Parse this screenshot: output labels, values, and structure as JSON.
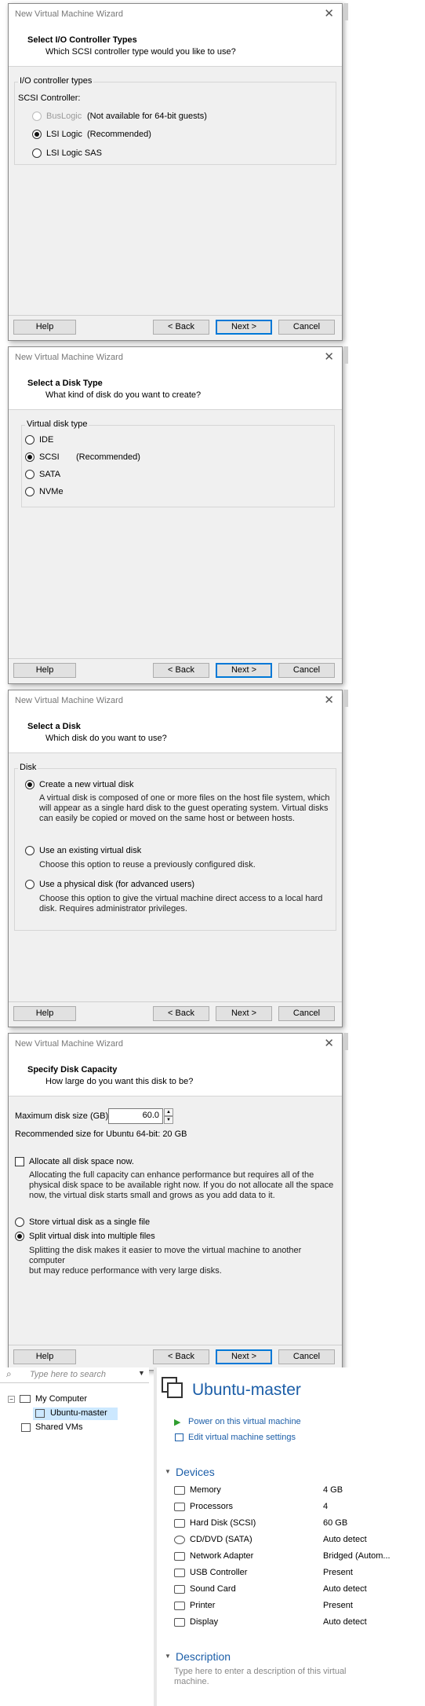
{
  "wizards": [
    {
      "title": "New Virtual Machine Wizard",
      "heading": "Select I/O Controller Types",
      "subheading": "Which SCSI controller type would you like to use?",
      "group_label": "I/O controller types",
      "field_label": "SCSI Controller:",
      "options": [
        {
          "label": "BusLogic",
          "note": "(Not available for 64-bit guests)",
          "state": "disabled"
        },
        {
          "label": "LSI Logic",
          "note": "(Recommended)",
          "state": "selected"
        },
        {
          "label": "LSI Logic SAS",
          "note": "",
          "state": "unselected"
        }
      ]
    },
    {
      "title": "New Virtual Machine Wizard",
      "heading": "Select a Disk Type",
      "subheading": "What kind of disk do you want to create?",
      "group_label": "Virtual disk type",
      "options": [
        {
          "label": "IDE",
          "note": "",
          "state": "unselected"
        },
        {
          "label": "SCSI",
          "note": "(Recommended)",
          "state": "selected"
        },
        {
          "label": "SATA",
          "note": "",
          "state": "unselected"
        },
        {
          "label": "NVMe",
          "note": "",
          "state": "unselected"
        }
      ]
    },
    {
      "title": "New Virtual Machine Wizard",
      "heading": "Select a Disk",
      "subheading": "Which disk do you want to use?",
      "group_label": "Disk",
      "options": [
        {
          "label": "Create a new virtual disk",
          "state": "selected",
          "desc": [
            "A virtual disk is composed of one or more files on the host file system, which",
            "will appear as a single hard disk to the guest operating system. Virtual disks",
            "can easily be copied or moved on the same host or between hosts."
          ]
        },
        {
          "label": "Use an existing virtual disk",
          "state": "unselected",
          "desc": [
            "Choose this option to reuse a previously configured disk."
          ]
        },
        {
          "label": "Use a physical disk (for advanced users)",
          "state": "unselected",
          "desc": [
            "Choose this option to give the virtual machine direct access to a local hard",
            "disk. Requires administrator privileges."
          ]
        }
      ]
    },
    {
      "title": "New Virtual Machine Wizard",
      "heading": "Specify Disk Capacity",
      "subheading": "How large do you want this disk to be?",
      "max_size_label": "Maximum disk size (GB):",
      "max_size_value": "60.0",
      "recommended": "Recommended size for Ubuntu 64-bit: 20 GB",
      "allocate_label": "Allocate all disk space now.",
      "allocate_checked": false,
      "allocate_desc": [
        "Allocating the full capacity can enhance performance but requires all of the",
        "physical disk space to be available right now. If you do not allocate all the space",
        "now, the virtual disk starts small and grows as you add data to it."
      ],
      "store_single": "Store virtual disk as a single file",
      "split_multi": "Split virtual disk into multiple files",
      "split_desc": [
        "Splitting the disk makes it easier to move the virtual machine to another computer",
        "but may reduce performance with very large disks."
      ]
    }
  ],
  "buttons": {
    "help": "Help",
    "back": "< Back",
    "next": "Next >",
    "cancel": "Cancel"
  },
  "library": {
    "search_placeholder": "Type here to search",
    "tree": [
      {
        "label": "My Computer",
        "level": 0,
        "expanded": true
      },
      {
        "label": "Ubuntu-master",
        "level": 1,
        "selected": true
      },
      {
        "label": "Shared VMs",
        "level": 0
      }
    ]
  },
  "vm": {
    "name": "Ubuntu-master",
    "power_on": "Power on this virtual machine",
    "edit_settings": "Edit virtual machine settings",
    "devices_heading": "Devices",
    "devices": [
      {
        "name": "Memory",
        "value": "4 GB",
        "icon": "memory-icon"
      },
      {
        "name": "Processors",
        "value": "4",
        "icon": "processor-icon"
      },
      {
        "name": "Hard Disk (SCSI)",
        "value": "60 GB",
        "icon": "hard-disk-icon"
      },
      {
        "name": "CD/DVD (SATA)",
        "value": "Auto detect",
        "icon": "cd-dvd-icon"
      },
      {
        "name": "Network Adapter",
        "value": "Bridged (Autom...",
        "icon": "network-adapter-icon"
      },
      {
        "name": "USB Controller",
        "value": "Present",
        "icon": "usb-icon"
      },
      {
        "name": "Sound Card",
        "value": "Auto detect",
        "icon": "sound-card-icon"
      },
      {
        "name": "Printer",
        "value": "Present",
        "icon": "printer-icon"
      },
      {
        "name": "Display",
        "value": "Auto detect",
        "icon": "display-icon"
      }
    ],
    "description_heading": "Description",
    "description_placeholder": [
      "Type here to enter a description of this virtual",
      "machine."
    ]
  },
  "colors": {
    "accent": "#0078d7",
    "link": "#1c5ea8",
    "play": "#2e9e2e"
  }
}
